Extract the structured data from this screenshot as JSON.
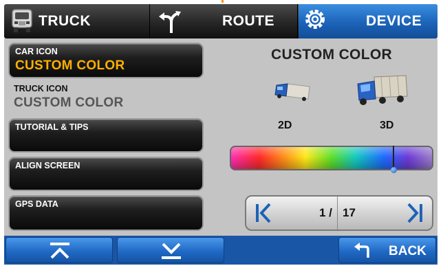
{
  "tabs": {
    "truck": {
      "label": "TRUCK",
      "icon": "truck-icon"
    },
    "route": {
      "label": "ROUTE",
      "icon": "route-fork-icon"
    },
    "device": {
      "label": "DEVICE",
      "icon": "gear-icon",
      "active": true
    }
  },
  "settings": {
    "car_icon": {
      "caption": "CAR ICON",
      "value": "CUSTOM COLOR"
    },
    "truck_icon": {
      "caption": "TRUCK ICON",
      "value": "CUSTOM COLOR"
    },
    "tutorial": {
      "label": "TUTORIAL & TIPS"
    },
    "align": {
      "label": "ALIGN SCREEN"
    },
    "gps": {
      "label": "GPS DATA"
    }
  },
  "preview": {
    "title": "CUSTOM COLOR",
    "label_2d": "2D",
    "label_3d": "3D",
    "hue_position": 0.8
  },
  "pager": {
    "current": "1 /",
    "total": "17"
  },
  "bottom": {
    "back_label": "BACK"
  },
  "colors": {
    "accent_blue": "#1c63b8",
    "value_orange": "#ffb000",
    "panel_gray": "#c4c4c4"
  }
}
